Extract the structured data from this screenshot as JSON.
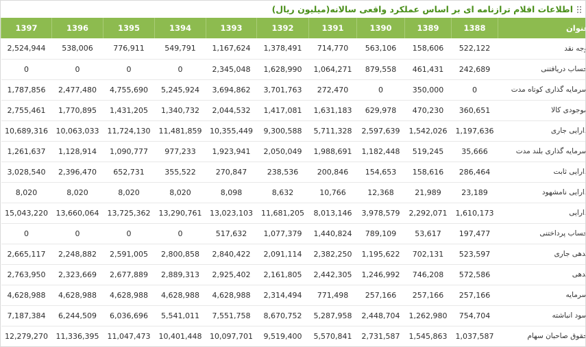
{
  "header": {
    "title": "اطلاعات اقلام ترازنامه ای بر اساس عملکرد واقعی سالانه(میلیون ریال)",
    "grip_icon": "grip-dots-icon"
  },
  "table": {
    "title_column": "عنوان",
    "years": [
      "1388",
      "1389",
      "1390",
      "1391",
      "1392",
      "1393",
      "1394",
      "1395",
      "1396",
      "1397"
    ],
    "rows": [
      {
        "label": "وجه نقد",
        "values": [
          "522,122",
          "158,606",
          "563,106",
          "714,770",
          "1,378,491",
          "1,167,624",
          "549,791",
          "776,911",
          "538,006",
          "2,524,944"
        ]
      },
      {
        "label": "حساب دریافتنی",
        "values": [
          "242,689",
          "461,431",
          "879,558",
          "1,064,271",
          "1,628,990",
          "2,345,048",
          "0",
          "0",
          "0",
          "0"
        ]
      },
      {
        "label": "سرمایه گذاری کوتاه مدت",
        "values": [
          "0",
          "350,000",
          "0",
          "272,470",
          "3,701,763",
          "3,694,862",
          "5,245,924",
          "4,755,690",
          "2,477,480",
          "1,787,856"
        ]
      },
      {
        "label": "موجودی کالا",
        "values": [
          "360,651",
          "470,230",
          "629,978",
          "1,631,183",
          "1,417,081",
          "2,044,532",
          "1,340,732",
          "1,431,205",
          "1,770,895",
          "2,755,461"
        ]
      },
      {
        "label": "دارایی جاری",
        "values": [
          "1,197,636",
          "1,542,026",
          "2,597,639",
          "5,711,328",
          "9,300,588",
          "10,355,449",
          "11,481,859",
          "11,724,130",
          "10,063,033",
          "10,689,316"
        ]
      },
      {
        "label": "سرمایه گذاری بلند مدت",
        "values": [
          "35,666",
          "519,245",
          "1,182,448",
          "1,988,691",
          "2,050,049",
          "1,923,941",
          "977,233",
          "1,090,777",
          "1,128,914",
          "1,261,637"
        ]
      },
      {
        "label": "دارایی ثابت",
        "values": [
          "286,464",
          "158,616",
          "154,653",
          "200,846",
          "238,536",
          "270,847",
          "355,522",
          "652,731",
          "2,396,470",
          "3,028,540"
        ]
      },
      {
        "label": "دارایی نامشهود",
        "values": [
          "23,189",
          "21,989",
          "12,368",
          "10,766",
          "8,632",
          "8,098",
          "8,020",
          "8,020",
          "8,020",
          "8,020"
        ]
      },
      {
        "label": "دارایی",
        "values": [
          "1,610,173",
          "2,292,071",
          "3,978,579",
          "8,013,146",
          "11,681,205",
          "13,023,103",
          "13,290,761",
          "13,725,362",
          "13,660,064",
          "15,043,220"
        ]
      },
      {
        "label": "حساب پرداختنی",
        "values": [
          "197,477",
          "53,617",
          "789,109",
          "1,440,824",
          "1,077,379",
          "517,632",
          "0",
          "0",
          "0",
          "0"
        ]
      },
      {
        "label": "بدهی جاری",
        "values": [
          "523,597",
          "702,131",
          "1,195,622",
          "2,382,250",
          "2,091,114",
          "2,840,422",
          "2,800,858",
          "2,591,005",
          "2,248,882",
          "2,665,117"
        ]
      },
      {
        "label": "بدهی",
        "values": [
          "572,586",
          "746,208",
          "1,246,992",
          "2,442,305",
          "2,161,805",
          "2,925,402",
          "2,889,313",
          "2,677,889",
          "2,323,669",
          "2,763,950"
        ]
      },
      {
        "label": "سرمایه",
        "values": [
          "257,166",
          "257,166",
          "257,166",
          "771,498",
          "2,314,494",
          "4,628,988",
          "4,628,988",
          "4,628,988",
          "4,628,988",
          "4,628,988"
        ]
      },
      {
        "label": "سود انباشته",
        "values": [
          "754,704",
          "1,262,980",
          "2,448,704",
          "5,287,958",
          "8,670,752",
          "7,551,758",
          "5,541,011",
          "6,036,696",
          "6,244,509",
          "7,187,384"
        ]
      },
      {
        "label": "حقوق صاحبان سهام",
        "values": [
          "1,037,587",
          "1,545,863",
          "2,731,587",
          "5,570,841",
          "9,519,400",
          "10,097,701",
          "10,401,448",
          "11,047,473",
          "11,336,395",
          "12,279,270"
        ]
      }
    ]
  }
}
